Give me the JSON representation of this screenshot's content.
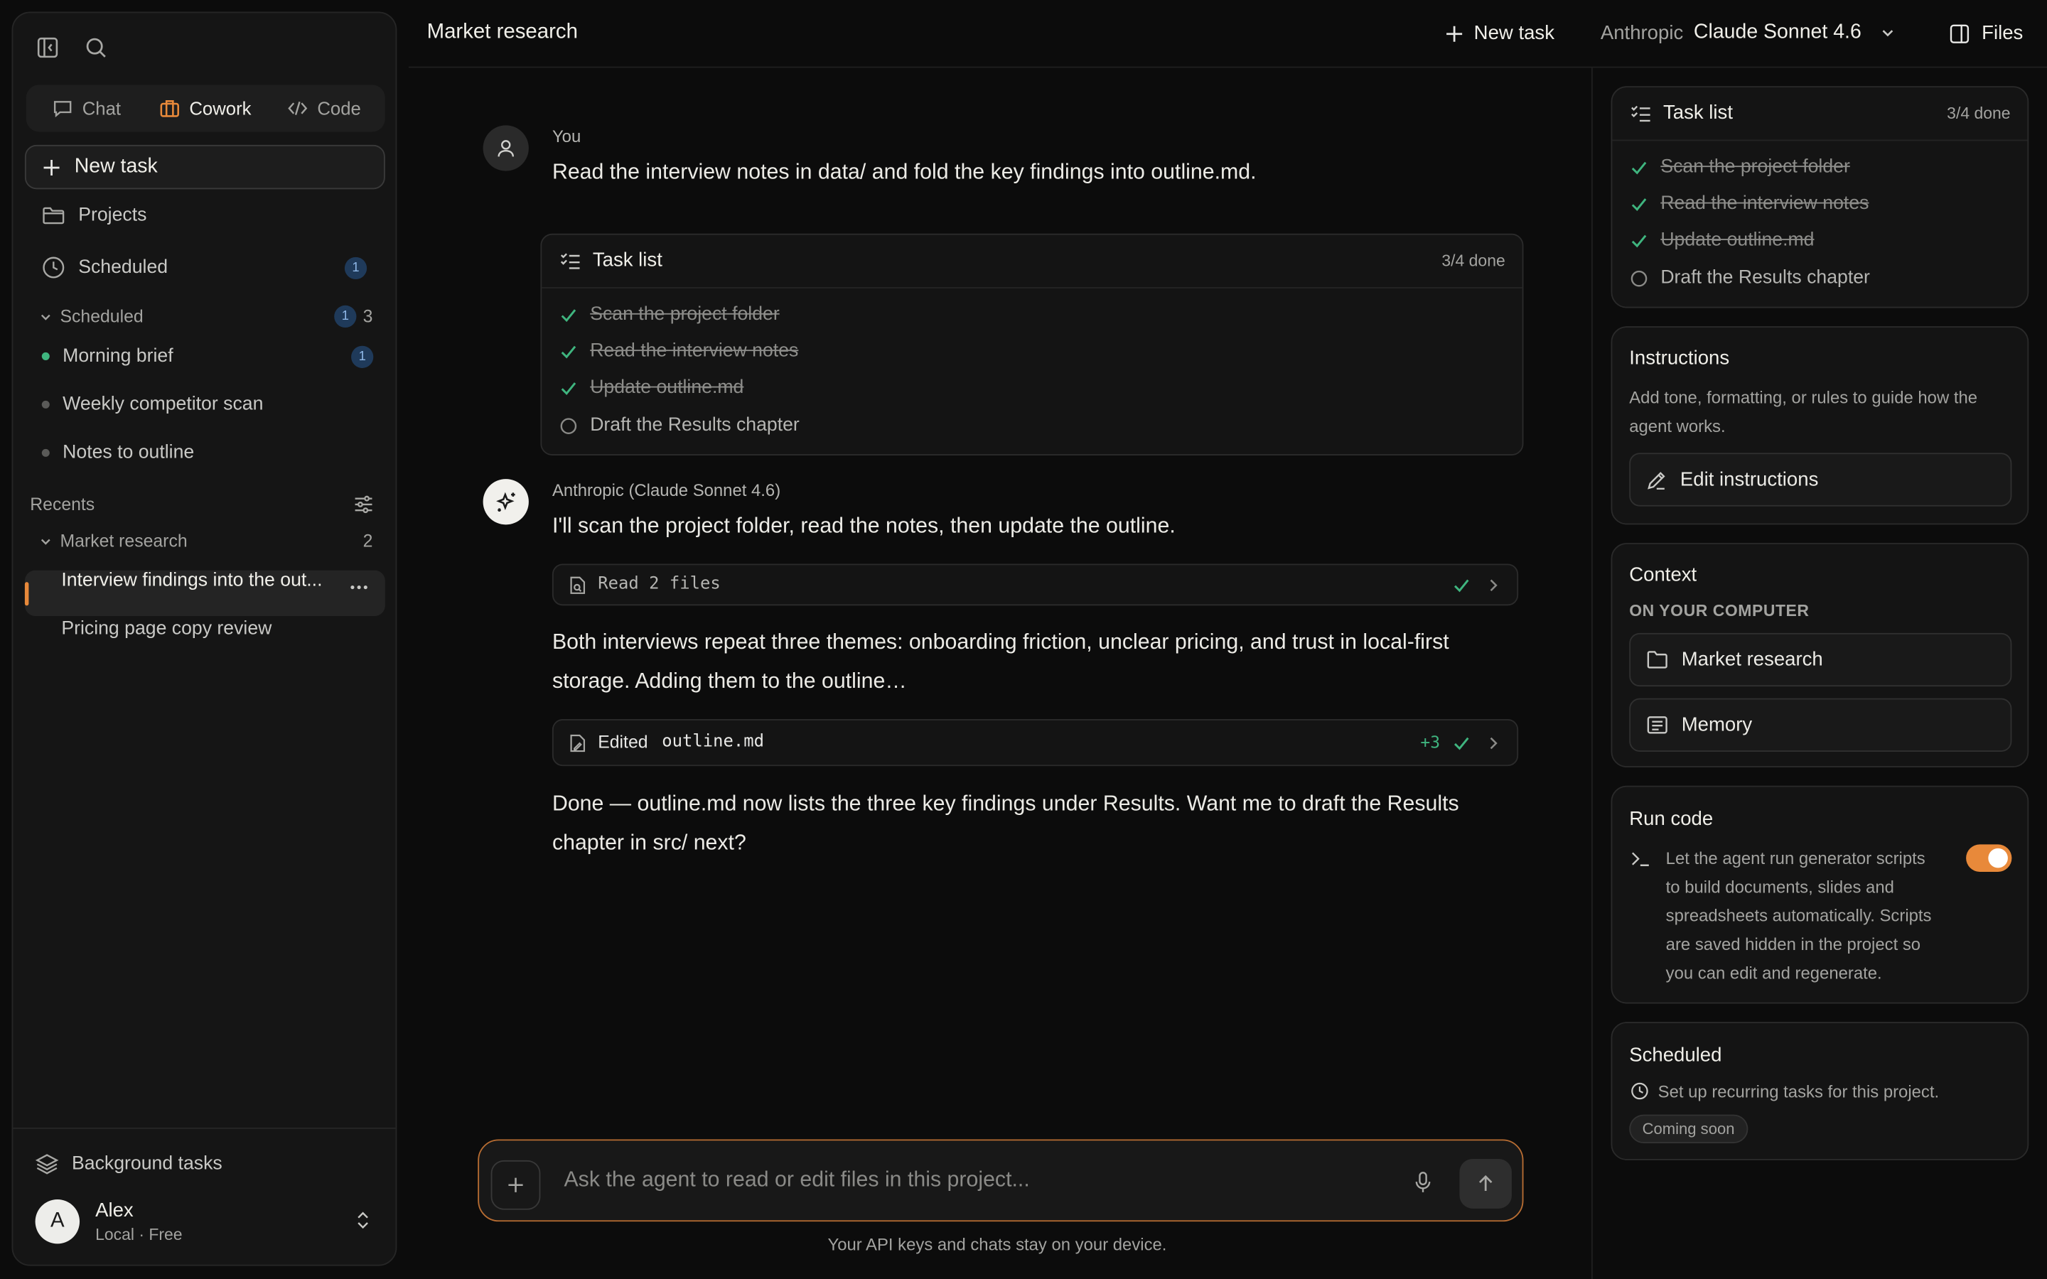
{
  "sidebar": {
    "modes": {
      "chat": "Chat",
      "cowork": "Cowork",
      "code": "Code"
    },
    "new_task": "New task",
    "nav": {
      "projects": "Projects",
      "scheduled": "Scheduled",
      "scheduled_badge": "1"
    },
    "scheduled_group": {
      "label": "Scheduled",
      "badge": "1",
      "count": "3",
      "items": [
        {
          "label": "Morning brief",
          "badge": "1"
        },
        {
          "label": "Weekly competitor scan"
        },
        {
          "label": "Notes to outline"
        }
      ]
    },
    "recents": {
      "label": "Recents",
      "group": {
        "label": "Market research",
        "count": "2"
      },
      "items": [
        {
          "label": "Interview findings into the out..."
        },
        {
          "label": "Pricing page copy review"
        }
      ]
    },
    "background_tasks": "Background tasks",
    "user": {
      "initial": "A",
      "name": "Alex",
      "plan": "Local · Free"
    }
  },
  "header": {
    "title": "Market research",
    "new_task": "New task",
    "provider": "Anthropic",
    "model": "Claude Sonnet 4.6",
    "files": "Files"
  },
  "chat": {
    "user": {
      "name": "You",
      "message": "Read the interview notes in data/ and fold the key findings into outline.md."
    },
    "task_list": {
      "title": "Task list",
      "status": "3/4 done",
      "items": [
        {
          "label": "Scan the project folder",
          "done": true
        },
        {
          "label": "Read the interview notes",
          "done": true
        },
        {
          "label": "Update outline.md",
          "done": true
        },
        {
          "label": "Draft the Results chapter",
          "done": false
        }
      ]
    },
    "assistant": {
      "name": "Anthropic (Claude Sonnet 4.6)",
      "intro": "I'll scan the project folder, read the notes, then update the outline.",
      "tool1": {
        "label": "Read 2 files"
      },
      "para1_line1": "Both interviews repeat three themes: onboarding friction, unclear pricing, and trust in local-first",
      "para1_line2": "storage. Adding them to the outline…",
      "tool2": {
        "verb": "Edited",
        "file": "outline.md",
        "diff": "+3"
      },
      "para2_line1": "Done — outline.md now lists the three key findings under Results. Want me to draft the Results",
      "para2_line2": "chapter in src/ next?"
    }
  },
  "composer": {
    "placeholder": "Ask the agent to read or edit files in this project...",
    "footer": "Your API keys and chats stay on your device."
  },
  "right_panel": {
    "task_list": {
      "title": "Task list",
      "status": "3/4 done",
      "items": [
        {
          "label": "Scan the project folder",
          "done": true
        },
        {
          "label": "Read the interview notes",
          "done": true
        },
        {
          "label": "Update outline.md",
          "done": true
        },
        {
          "label": "Draft the Results chapter",
          "done": false
        }
      ]
    },
    "instructions": {
      "title": "Instructions",
      "desc_line1": "Add tone, formatting, or rules to guide how the",
      "desc_line2": "agent works.",
      "button": "Edit instructions"
    },
    "context": {
      "title": "Context",
      "subtitle": "ON YOUR COMPUTER",
      "items": [
        {
          "label": "Market research"
        },
        {
          "label": "Memory"
        }
      ]
    },
    "run_code": {
      "title": "Run code",
      "lines": [
        "Let the agent run generator scripts",
        "to build documents, slides and",
        "spreadsheets automatically. Scripts",
        "are saved hidden in the project so",
        "you can edit and regenerate."
      ],
      "enabled": true
    },
    "scheduled": {
      "title": "Scheduled",
      "desc": "Set up recurring tasks for this project.",
      "pill": "Coming soon"
    }
  },
  "colors": {
    "accent": "#e8893a",
    "check": "#3fb57f",
    "background": "#0c0c0c"
  }
}
